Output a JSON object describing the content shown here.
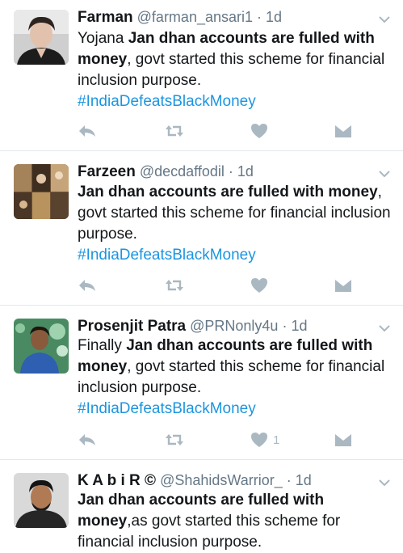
{
  "tweets": [
    {
      "name": "Farman",
      "handle": "@farman_ansari1",
      "time": "· 1d",
      "text_prefix": "Yojana ",
      "text_bold": "Jan dhan accounts are fulled with money",
      "text_rest": ", govt started this scheme for financial inclusion purpose.",
      "hashtag": "#IndiaDefeatsBlackMoney",
      "likes": ""
    },
    {
      "name": "Farzeen",
      "handle": "@decdaffodil",
      "time": "· 1d",
      "text_prefix": "",
      "text_bold": "Jan dhan accounts are fulled with money",
      "text_rest": ", govt started this scheme for financial inclusion purpose.",
      "hashtag": "#IndiaDefeatsBlackMoney",
      "likes": ""
    },
    {
      "name": "Prosenjit Patra",
      "handle": "@PRNonly4u",
      "time": "· 1d",
      "text_prefix": "Finally ",
      "text_bold": "Jan dhan accounts are fulled with money",
      "text_rest": ", govt started this scheme for financial inclusion purpose.",
      "hashtag": "#IndiaDefeatsBlackMoney",
      "likes": "1"
    },
    {
      "name": "K A b i R ©",
      "handle": "@ShahidsWarrior_",
      "time": "· 1d",
      "text_prefix": "",
      "text_bold": "Jan dhan accounts are fulled with money",
      "text_rest": ",as govt started this scheme for financial inclusion purpose.",
      "hashtag": "",
      "likes": ""
    }
  ],
  "icons": {
    "reply": "reply-icon",
    "retweet": "retweet-icon",
    "like": "heart-icon",
    "dm": "direct-message-icon",
    "caret": "chevron-down-icon"
  },
  "colors": {
    "hashtag": "#1b95e0",
    "action_icon": "#aab8c2",
    "secondary_text": "#657786"
  }
}
